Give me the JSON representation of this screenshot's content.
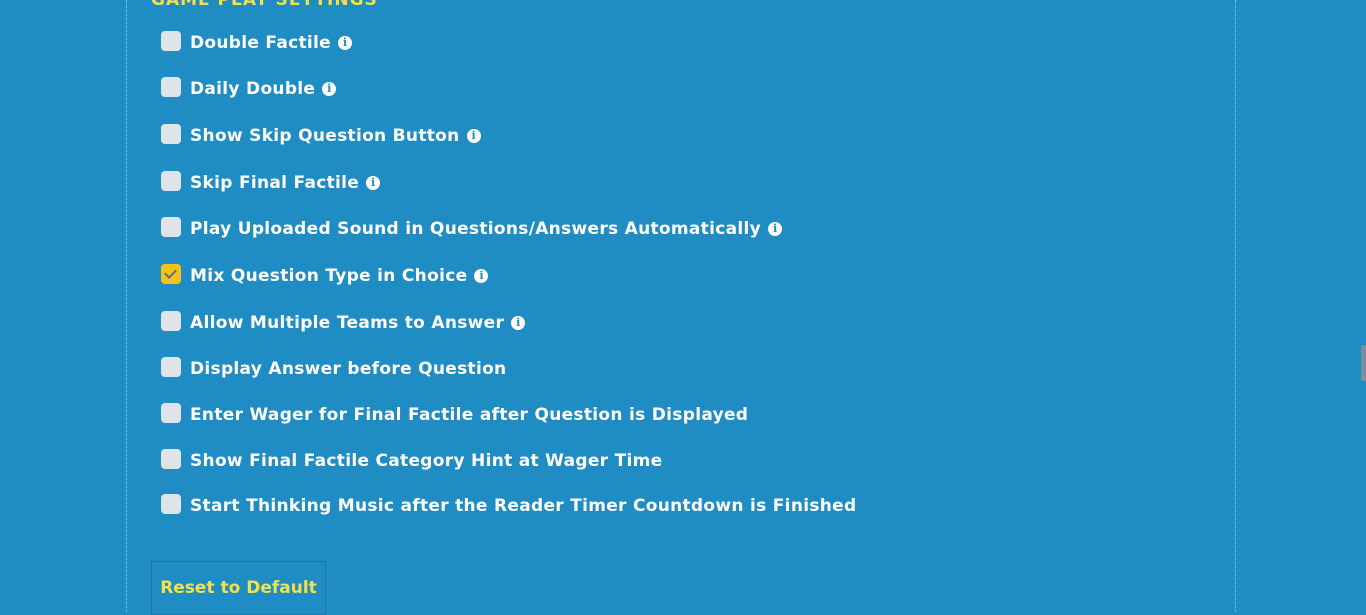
{
  "section": {
    "heading": "GAME PLAY SETTINGS"
  },
  "settings": [
    {
      "label": "Double Factile",
      "checked": false,
      "info": true
    },
    {
      "label": "Daily Double",
      "checked": false,
      "info": true
    },
    {
      "label": "Show Skip Question Button",
      "checked": false,
      "info": true
    },
    {
      "label": "Skip Final Factile",
      "checked": false,
      "info": true
    },
    {
      "label": "Play Uploaded Sound in Questions/Answers Automatically",
      "checked": false,
      "info": true
    },
    {
      "label": "Mix Question Type in Choice",
      "checked": true,
      "info": true
    },
    {
      "label": "Allow Multiple Teams to Answer",
      "checked": false,
      "info": true
    },
    {
      "label": "Display Answer before Question",
      "checked": false,
      "info": false
    },
    {
      "label": "Enter Wager for Final Factile after Question is Displayed",
      "checked": false,
      "info": false
    },
    {
      "label": "Show Final Factile Category Hint at Wager Time",
      "checked": false,
      "info": false
    },
    {
      "label": "Start Thinking Music after the Reader Timer Countdown is Finished",
      "checked": false,
      "info": false
    }
  ],
  "reset_button": {
    "label": "Reset to Default"
  },
  "icons": {
    "info": "info-icon",
    "check": "check-icon"
  },
  "colors": {
    "background": "#208cc4",
    "accent": "#f2e24a",
    "checked": "#f3c31a",
    "text": "#ffffff"
  }
}
